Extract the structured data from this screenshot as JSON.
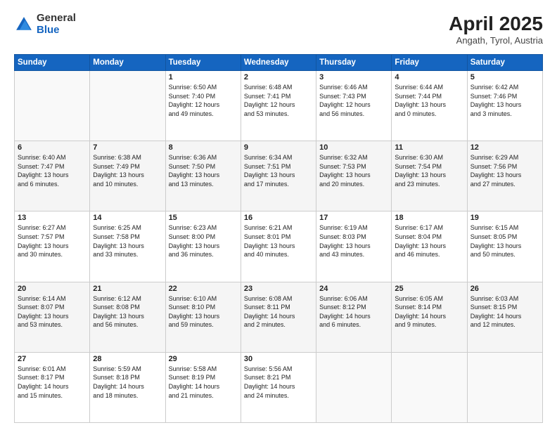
{
  "header": {
    "logo_general": "General",
    "logo_blue": "Blue",
    "title": "April 2025",
    "location": "Angath, Tyrol, Austria"
  },
  "weekdays": [
    "Sunday",
    "Monday",
    "Tuesday",
    "Wednesday",
    "Thursday",
    "Friday",
    "Saturday"
  ],
  "weeks": [
    [
      {
        "day": "",
        "info": ""
      },
      {
        "day": "",
        "info": ""
      },
      {
        "day": "1",
        "info": "Sunrise: 6:50 AM\nSunset: 7:40 PM\nDaylight: 12 hours\nand 49 minutes."
      },
      {
        "day": "2",
        "info": "Sunrise: 6:48 AM\nSunset: 7:41 PM\nDaylight: 12 hours\nand 53 minutes."
      },
      {
        "day": "3",
        "info": "Sunrise: 6:46 AM\nSunset: 7:43 PM\nDaylight: 12 hours\nand 56 minutes."
      },
      {
        "day": "4",
        "info": "Sunrise: 6:44 AM\nSunset: 7:44 PM\nDaylight: 13 hours\nand 0 minutes."
      },
      {
        "day": "5",
        "info": "Sunrise: 6:42 AM\nSunset: 7:46 PM\nDaylight: 13 hours\nand 3 minutes."
      }
    ],
    [
      {
        "day": "6",
        "info": "Sunrise: 6:40 AM\nSunset: 7:47 PM\nDaylight: 13 hours\nand 6 minutes."
      },
      {
        "day": "7",
        "info": "Sunrise: 6:38 AM\nSunset: 7:49 PM\nDaylight: 13 hours\nand 10 minutes."
      },
      {
        "day": "8",
        "info": "Sunrise: 6:36 AM\nSunset: 7:50 PM\nDaylight: 13 hours\nand 13 minutes."
      },
      {
        "day": "9",
        "info": "Sunrise: 6:34 AM\nSunset: 7:51 PM\nDaylight: 13 hours\nand 17 minutes."
      },
      {
        "day": "10",
        "info": "Sunrise: 6:32 AM\nSunset: 7:53 PM\nDaylight: 13 hours\nand 20 minutes."
      },
      {
        "day": "11",
        "info": "Sunrise: 6:30 AM\nSunset: 7:54 PM\nDaylight: 13 hours\nand 23 minutes."
      },
      {
        "day": "12",
        "info": "Sunrise: 6:29 AM\nSunset: 7:56 PM\nDaylight: 13 hours\nand 27 minutes."
      }
    ],
    [
      {
        "day": "13",
        "info": "Sunrise: 6:27 AM\nSunset: 7:57 PM\nDaylight: 13 hours\nand 30 minutes."
      },
      {
        "day": "14",
        "info": "Sunrise: 6:25 AM\nSunset: 7:58 PM\nDaylight: 13 hours\nand 33 minutes."
      },
      {
        "day": "15",
        "info": "Sunrise: 6:23 AM\nSunset: 8:00 PM\nDaylight: 13 hours\nand 36 minutes."
      },
      {
        "day": "16",
        "info": "Sunrise: 6:21 AM\nSunset: 8:01 PM\nDaylight: 13 hours\nand 40 minutes."
      },
      {
        "day": "17",
        "info": "Sunrise: 6:19 AM\nSunset: 8:03 PM\nDaylight: 13 hours\nand 43 minutes."
      },
      {
        "day": "18",
        "info": "Sunrise: 6:17 AM\nSunset: 8:04 PM\nDaylight: 13 hours\nand 46 minutes."
      },
      {
        "day": "19",
        "info": "Sunrise: 6:15 AM\nSunset: 8:05 PM\nDaylight: 13 hours\nand 50 minutes."
      }
    ],
    [
      {
        "day": "20",
        "info": "Sunrise: 6:14 AM\nSunset: 8:07 PM\nDaylight: 13 hours\nand 53 minutes."
      },
      {
        "day": "21",
        "info": "Sunrise: 6:12 AM\nSunset: 8:08 PM\nDaylight: 13 hours\nand 56 minutes."
      },
      {
        "day": "22",
        "info": "Sunrise: 6:10 AM\nSunset: 8:10 PM\nDaylight: 13 hours\nand 59 minutes."
      },
      {
        "day": "23",
        "info": "Sunrise: 6:08 AM\nSunset: 8:11 PM\nDaylight: 14 hours\nand 2 minutes."
      },
      {
        "day": "24",
        "info": "Sunrise: 6:06 AM\nSunset: 8:12 PM\nDaylight: 14 hours\nand 6 minutes."
      },
      {
        "day": "25",
        "info": "Sunrise: 6:05 AM\nSunset: 8:14 PM\nDaylight: 14 hours\nand 9 minutes."
      },
      {
        "day": "26",
        "info": "Sunrise: 6:03 AM\nSunset: 8:15 PM\nDaylight: 14 hours\nand 12 minutes."
      }
    ],
    [
      {
        "day": "27",
        "info": "Sunrise: 6:01 AM\nSunset: 8:17 PM\nDaylight: 14 hours\nand 15 minutes."
      },
      {
        "day": "28",
        "info": "Sunrise: 5:59 AM\nSunset: 8:18 PM\nDaylight: 14 hours\nand 18 minutes."
      },
      {
        "day": "29",
        "info": "Sunrise: 5:58 AM\nSunset: 8:19 PM\nDaylight: 14 hours\nand 21 minutes."
      },
      {
        "day": "30",
        "info": "Sunrise: 5:56 AM\nSunset: 8:21 PM\nDaylight: 14 hours\nand 24 minutes."
      },
      {
        "day": "",
        "info": ""
      },
      {
        "day": "",
        "info": ""
      },
      {
        "day": "",
        "info": ""
      }
    ]
  ]
}
